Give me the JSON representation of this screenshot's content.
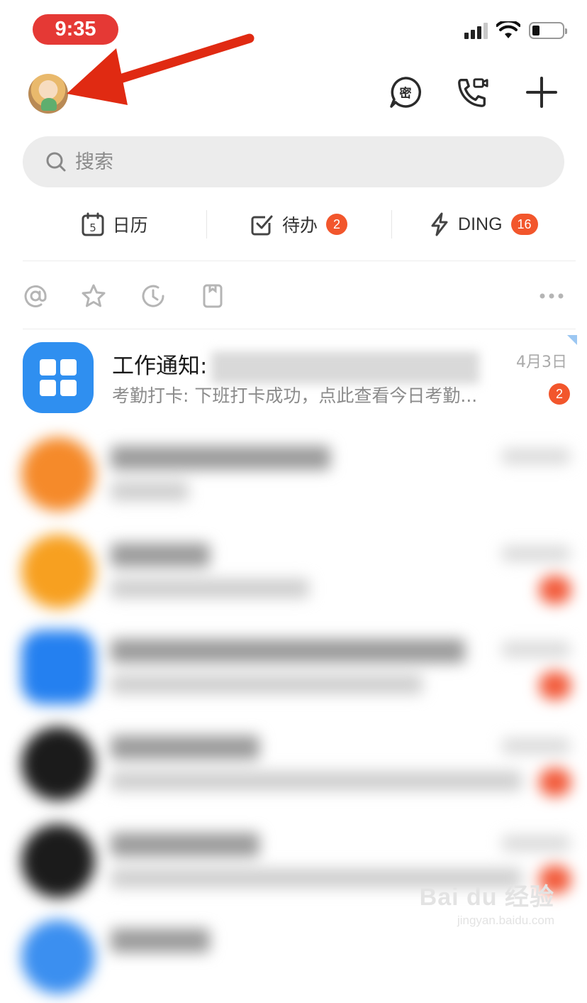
{
  "status_bar": {
    "time": "9:35"
  },
  "search": {
    "placeholder": "搜索"
  },
  "quick_actions": [
    {
      "label": "日历",
      "icon": "calendar-icon",
      "icon_text": "5"
    },
    {
      "label": "待办",
      "icon": "todo-check-icon",
      "badge": "2"
    },
    {
      "label": "DING",
      "icon": "lightning-icon",
      "badge": "16"
    }
  ],
  "filters": [
    "at-icon",
    "star-icon",
    "clock-icon",
    "bookmark-icon",
    "more-icon"
  ],
  "conversations": [
    {
      "title_prefix": "工作通知:",
      "preview": "考勤打卡: 下班打卡成功，点此查看今日考勤...",
      "date": "4月3日",
      "badge": "2"
    }
  ],
  "watermark": {
    "main": "Bai du 经验",
    "sub": "jingyan.baidu.com"
  },
  "colors": {
    "accent_red": "#e53935",
    "badge_orange": "#f2562c",
    "app_blue": "#2f8ff0"
  }
}
